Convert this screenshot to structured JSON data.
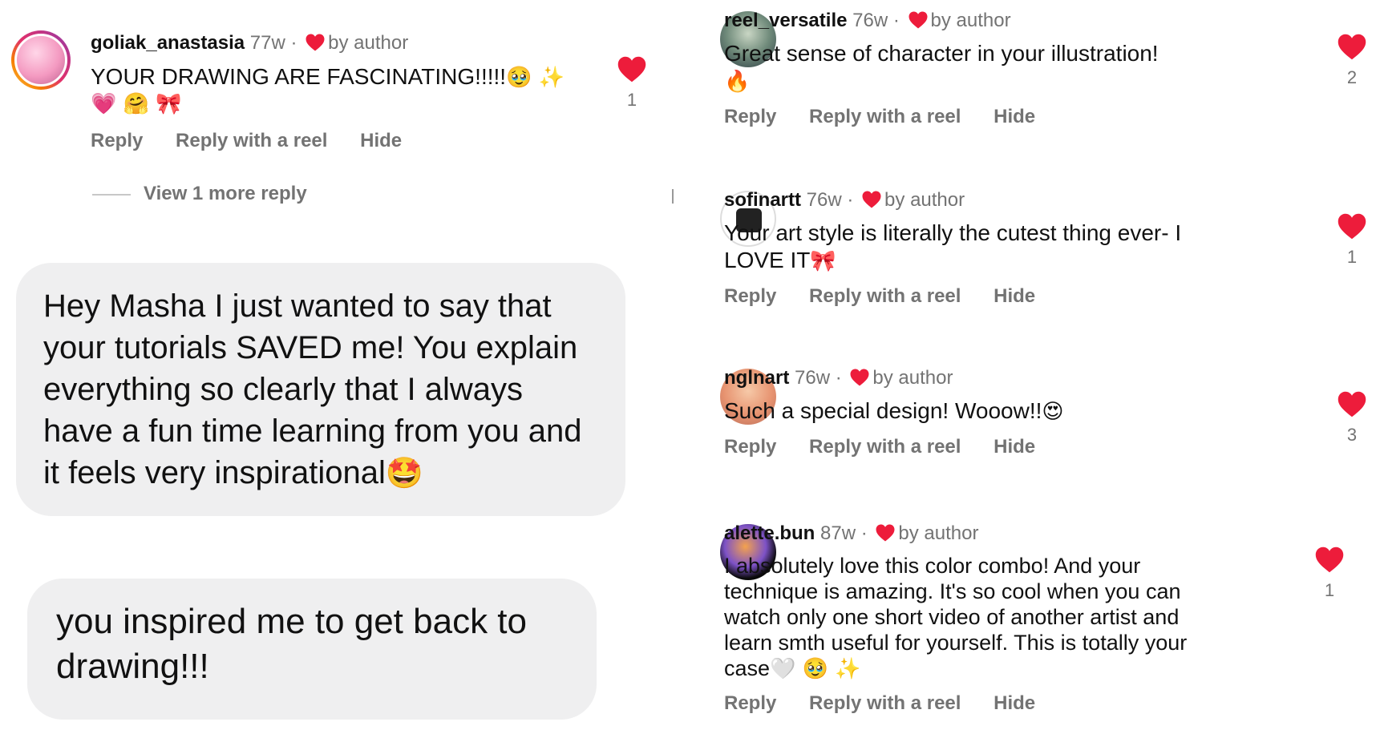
{
  "by_author_label": "by author",
  "dot": "·",
  "actions": {
    "reply": "Reply",
    "reply_reel": "Reply with a reel",
    "hide": "Hide"
  },
  "left": {
    "comment": {
      "user": "goliak_anastasia",
      "time": "77w",
      "text": "YOUR DRAWING ARE FASCINATING!!!!!",
      "emojis_line1": "🥹 ✨",
      "emojis_line2": "💗 🤗 🎀",
      "likes": "1"
    },
    "view_more": "View 1 more reply",
    "bubble1": "Hey Masha I just wanted to say that your tutorials SAVED me! You explain everything so clearly that I always have a fun time learning from you and it feels very inspirational",
    "bubble1_emoji": "🤩",
    "bubble2": "you inspired me to get back to drawing!!!"
  },
  "right": [
    {
      "user": "reel_versatile",
      "time": "76w",
      "text": "Great sense of character in your illustration!",
      "emoji": "🔥",
      "likes": "2"
    },
    {
      "user": "sofinartt",
      "time": "76w",
      "text": "Your art style is literally the cutest thing ever- I LOVE IT",
      "emoji": "🎀",
      "likes": "1"
    },
    {
      "user": "nglnart",
      "time": "76w",
      "text": "Such a special design! Wooow!!",
      "emoji": "😍",
      "likes": "3"
    },
    {
      "user": "alette.bun",
      "time": "87w",
      "text": "I absolutely love this color combo! And your technique is amazing. It's so cool when you can watch only one short video of another artist and learn smth useful for yourself. This is totally your case",
      "emoji": "🤍 🥹 ✨",
      "likes": "1"
    }
  ],
  "colors": {
    "heart": "#ed1c3b",
    "muted": "#737373",
    "bubble": "#efeff0"
  }
}
